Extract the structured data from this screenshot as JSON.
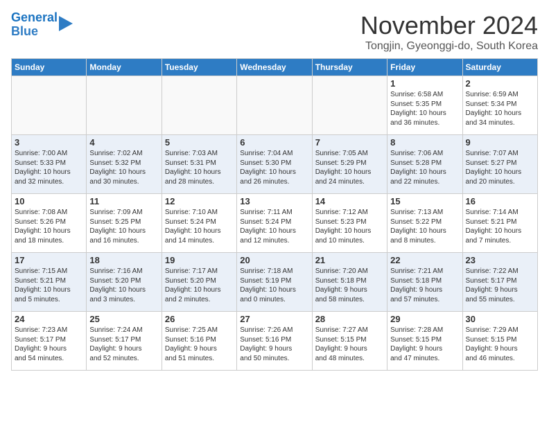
{
  "header": {
    "logo_line1": "General",
    "logo_line2": "Blue",
    "month": "November 2024",
    "location": "Tongjin, Gyeonggi-do, South Korea"
  },
  "weekdays": [
    "Sunday",
    "Monday",
    "Tuesday",
    "Wednesday",
    "Thursday",
    "Friday",
    "Saturday"
  ],
  "weeks": [
    [
      {
        "day": "",
        "info": ""
      },
      {
        "day": "",
        "info": ""
      },
      {
        "day": "",
        "info": ""
      },
      {
        "day": "",
        "info": ""
      },
      {
        "day": "",
        "info": ""
      },
      {
        "day": "1",
        "info": "Sunrise: 6:58 AM\nSunset: 5:35 PM\nDaylight: 10 hours\nand 36 minutes."
      },
      {
        "day": "2",
        "info": "Sunrise: 6:59 AM\nSunset: 5:34 PM\nDaylight: 10 hours\nand 34 minutes."
      }
    ],
    [
      {
        "day": "3",
        "info": "Sunrise: 7:00 AM\nSunset: 5:33 PM\nDaylight: 10 hours\nand 32 minutes."
      },
      {
        "day": "4",
        "info": "Sunrise: 7:02 AM\nSunset: 5:32 PM\nDaylight: 10 hours\nand 30 minutes."
      },
      {
        "day": "5",
        "info": "Sunrise: 7:03 AM\nSunset: 5:31 PM\nDaylight: 10 hours\nand 28 minutes."
      },
      {
        "day": "6",
        "info": "Sunrise: 7:04 AM\nSunset: 5:30 PM\nDaylight: 10 hours\nand 26 minutes."
      },
      {
        "day": "7",
        "info": "Sunrise: 7:05 AM\nSunset: 5:29 PM\nDaylight: 10 hours\nand 24 minutes."
      },
      {
        "day": "8",
        "info": "Sunrise: 7:06 AM\nSunset: 5:28 PM\nDaylight: 10 hours\nand 22 minutes."
      },
      {
        "day": "9",
        "info": "Sunrise: 7:07 AM\nSunset: 5:27 PM\nDaylight: 10 hours\nand 20 minutes."
      }
    ],
    [
      {
        "day": "10",
        "info": "Sunrise: 7:08 AM\nSunset: 5:26 PM\nDaylight: 10 hours\nand 18 minutes."
      },
      {
        "day": "11",
        "info": "Sunrise: 7:09 AM\nSunset: 5:25 PM\nDaylight: 10 hours\nand 16 minutes."
      },
      {
        "day": "12",
        "info": "Sunrise: 7:10 AM\nSunset: 5:24 PM\nDaylight: 10 hours\nand 14 minutes."
      },
      {
        "day": "13",
        "info": "Sunrise: 7:11 AM\nSunset: 5:24 PM\nDaylight: 10 hours\nand 12 minutes."
      },
      {
        "day": "14",
        "info": "Sunrise: 7:12 AM\nSunset: 5:23 PM\nDaylight: 10 hours\nand 10 minutes."
      },
      {
        "day": "15",
        "info": "Sunrise: 7:13 AM\nSunset: 5:22 PM\nDaylight: 10 hours\nand 8 minutes."
      },
      {
        "day": "16",
        "info": "Sunrise: 7:14 AM\nSunset: 5:21 PM\nDaylight: 10 hours\nand 7 minutes."
      }
    ],
    [
      {
        "day": "17",
        "info": "Sunrise: 7:15 AM\nSunset: 5:21 PM\nDaylight: 10 hours\nand 5 minutes."
      },
      {
        "day": "18",
        "info": "Sunrise: 7:16 AM\nSunset: 5:20 PM\nDaylight: 10 hours\nand 3 minutes."
      },
      {
        "day": "19",
        "info": "Sunrise: 7:17 AM\nSunset: 5:20 PM\nDaylight: 10 hours\nand 2 minutes."
      },
      {
        "day": "20",
        "info": "Sunrise: 7:18 AM\nSunset: 5:19 PM\nDaylight: 10 hours\nand 0 minutes."
      },
      {
        "day": "21",
        "info": "Sunrise: 7:20 AM\nSunset: 5:18 PM\nDaylight: 9 hours\nand 58 minutes."
      },
      {
        "day": "22",
        "info": "Sunrise: 7:21 AM\nSunset: 5:18 PM\nDaylight: 9 hours\nand 57 minutes."
      },
      {
        "day": "23",
        "info": "Sunrise: 7:22 AM\nSunset: 5:17 PM\nDaylight: 9 hours\nand 55 minutes."
      }
    ],
    [
      {
        "day": "24",
        "info": "Sunrise: 7:23 AM\nSunset: 5:17 PM\nDaylight: 9 hours\nand 54 minutes."
      },
      {
        "day": "25",
        "info": "Sunrise: 7:24 AM\nSunset: 5:17 PM\nDaylight: 9 hours\nand 52 minutes."
      },
      {
        "day": "26",
        "info": "Sunrise: 7:25 AM\nSunset: 5:16 PM\nDaylight: 9 hours\nand 51 minutes."
      },
      {
        "day": "27",
        "info": "Sunrise: 7:26 AM\nSunset: 5:16 PM\nDaylight: 9 hours\nand 50 minutes."
      },
      {
        "day": "28",
        "info": "Sunrise: 7:27 AM\nSunset: 5:15 PM\nDaylight: 9 hours\nand 48 minutes."
      },
      {
        "day": "29",
        "info": "Sunrise: 7:28 AM\nSunset: 5:15 PM\nDaylight: 9 hours\nand 47 minutes."
      },
      {
        "day": "30",
        "info": "Sunrise: 7:29 AM\nSunset: 5:15 PM\nDaylight: 9 hours\nand 46 minutes."
      }
    ]
  ]
}
